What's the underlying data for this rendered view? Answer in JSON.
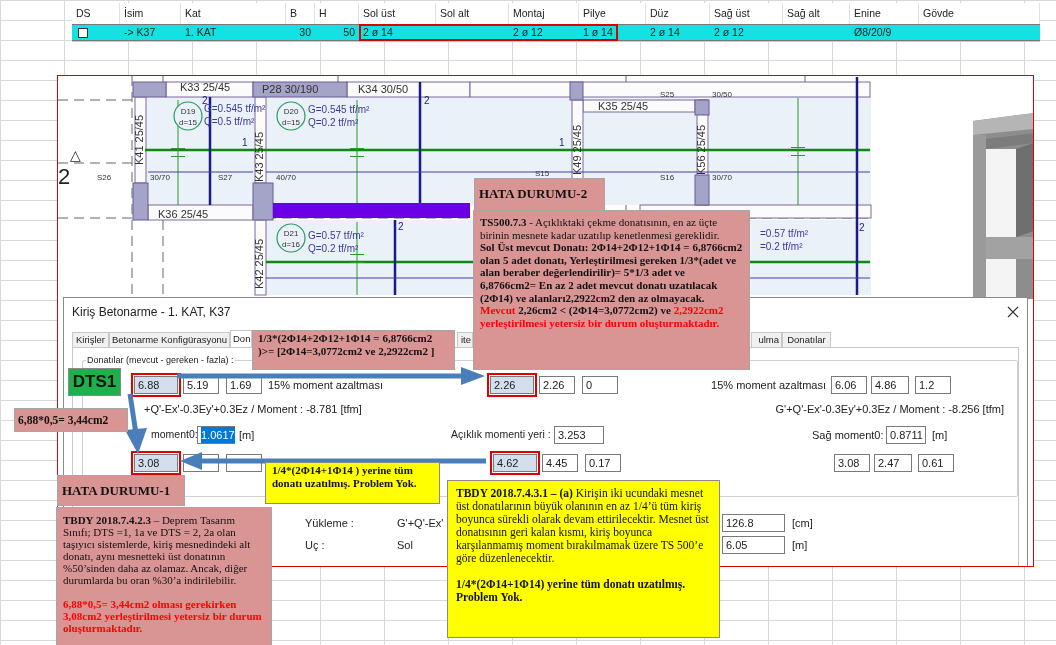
{
  "sheet_table": {
    "columns": [
      "DS",
      "İsim",
      "Kat",
      "B",
      "H",
      "Sol üst",
      "Sol alt",
      "Montaj",
      "Pilye",
      "Düz",
      "Sağ üst",
      "Sağ alt",
      "Enine",
      "Gövde"
    ],
    "rows": [
      {
        "selected": true,
        "cells": [
          {
            "kind": "checkbox",
            "checked": false
          },
          {
            "kind": "text",
            "text": "-> K37",
            "marked": false
          },
          {
            "kind": "text",
            "text": "1. KAT",
            "marked": false
          },
          {
            "kind": "text",
            "text": "30",
            "marked": false
          },
          {
            "kind": "text",
            "text": "50",
            "marked": false
          },
          {
            "kind": "text",
            "text": "2 ø 14",
            "marked": true
          },
          {
            "kind": "text",
            "marked": true
          },
          {
            "kind": "text",
            "text": "2 ø 12",
            "marked": true
          },
          {
            "kind": "text",
            "text": "1 ø 14",
            "marked": true
          },
          {
            "kind": "text",
            "text": "2 ø 14",
            "marked": false
          },
          {
            "kind": "text",
            "text": "2 ø 12",
            "marked": false
          },
          {
            "kind": "text",
            "marked": false
          },
          {
            "kind": "text",
            "text": "Ø8/20/9",
            "marked": false
          },
          {
            "kind": "text",
            "marked": false
          }
        ]
      }
    ]
  },
  "cad_drawing": {
    "labels": [
      {
        "text": "K33 25/45",
        "kind": "beam"
      },
      {
        "text": "P28 30/190",
        "kind": "beam"
      },
      {
        "text": "K34 30/50",
        "kind": "beam"
      },
      {
        "text": "G=0.545 tf/m²",
        "kind": "load"
      },
      {
        "text": "Q=0.5 tf/m²",
        "kind": "load"
      },
      {
        "text": "G=0.545 tf/m²",
        "kind": "load"
      },
      {
        "text": "Q=0.2 tf/m²",
        "kind": "load"
      },
      {
        "text": "K41 25/45",
        "kind": "beam"
      },
      {
        "text": "K43 25/45",
        "kind": "beam"
      },
      {
        "text": "△",
        "kind": "axis"
      },
      {
        "text": "2",
        "kind": "axis"
      },
      {
        "text": "S26",
        "kind": "span"
      },
      {
        "text": "30/70",
        "kind": "span"
      },
      {
        "text": "S27",
        "kind": "span"
      },
      {
        "text": "40/70",
        "kind": "span"
      },
      {
        "text": "K36 25/45",
        "kind": "beam"
      },
      {
        "text": "G=0.57 tf/m²",
        "kind": "load"
      },
      {
        "text": "Q=0.2 tf/m²",
        "kind": "load"
      },
      {
        "text": "K42 25/45",
        "kind": "beam"
      },
      {
        "text": "K35 25/45",
        "kind": "beam"
      },
      {
        "text": "S25",
        "kind": "span"
      },
      {
        "text": "30/50",
        "kind": "span"
      },
      {
        "text": "K49 25/45",
        "kind": "beam"
      },
      {
        "text": "K56 25/45",
        "kind": "beam"
      },
      {
        "text": "S15",
        "kind": "span"
      },
      {
        "text": "S16",
        "kind": "span"
      },
      {
        "text": "30/70",
        "kind": "span"
      },
      {
        "text": "=0.57 tf/m²",
        "kind": "load"
      },
      {
        "text": "=0.2 tf/m²",
        "kind": "load"
      },
      {
        "text": "2",
        "kind": "mark"
      },
      {
        "text": "2",
        "kind": "mark"
      },
      {
        "text": "1",
        "kind": "mark"
      },
      {
        "text": "2",
        "kind": "mark"
      },
      {
        "text": "1",
        "kind": "mark"
      },
      {
        "text": "2",
        "kind": "mark"
      }
    ],
    "slab_tags": [
      {
        "name": "D19",
        "thickness": "d=15"
      },
      {
        "name": "D20",
        "thickness": "d=15"
      },
      {
        "name": "D21",
        "thickness": "d=16"
      }
    ]
  },
  "dialog": {
    "title": "Kiriş Betonarme - 1. KAT, K37",
    "tabs": [
      {
        "label": "Kirişler",
        "selected": false
      },
      {
        "label": "Betonarme Konfigürasyonu",
        "selected": false
      },
      {
        "label": "Don",
        "selected": true
      },
      {
        "label": "ite",
        "selected": false
      },
      {
        "label": "ulma",
        "selected": false
      },
      {
        "label": "Donatılar",
        "selected": false
      }
    ],
    "group_label": "Donatılar (mevcut - gereken - fazla) :",
    "top_row": {
      "left": [
        {
          "value": "6.88",
          "marked": true
        },
        {
          "value": "5.19",
          "marked": false
        },
        {
          "value": "1.69",
          "marked": false
        }
      ],
      "left_note": "15% moment azaltması",
      "middle": [
        {
          "value": "2.26",
          "marked": true
        },
        {
          "value": "2.26",
          "marked": false
        },
        {
          "value": "0",
          "marked": false
        }
      ],
      "right_note": "15% moment azaltması",
      "right": [
        {
          "value": "6.06",
          "marked": false
        },
        {
          "value": "4.86",
          "marked": false
        },
        {
          "value": "1.2",
          "marked": false
        }
      ]
    },
    "moment_left": "+Q'-Ex'-0.3Ey'+0.3Ez / Moment : -8.781 [tfm]",
    "moment_right": "G'+Q'-Ex'-0.3Ey'+0.3Ez / Moment : -8.256 [tfm]",
    "left_moment0": {
      "label": "moment0:",
      "field": {
        "value": "1.0617",
        "selected": true
      },
      "unit": "[m]"
    },
    "span_location": {
      "label": "Açıklık momenti yeri :",
      "field": {
        "value": "3.253",
        "selected": false
      }
    },
    "right_moment0": {
      "label": "Sağ moment0:",
      "field": {
        "value": "0.8711",
        "selected": false
      },
      "unit": "[m]"
    },
    "bottom_row": {
      "left": [
        {
          "value": "3.08",
          "marked": true
        },
        {
          "marked": false
        },
        {
          "marked": false
        }
      ],
      "middle": [
        {
          "value": "4.62",
          "marked": true
        },
        {
          "value": "4.45",
          "marked": false
        },
        {
          "value": "0.17",
          "marked": false
        }
      ],
      "right": [
        {
          "value": "3.08",
          "marked": false
        },
        {
          "value": "2.47",
          "marked": false
        },
        {
          "value": "0.61",
          "marked": false
        }
      ]
    },
    "loading": {
      "label": "Yükleme :",
      "value": "G'+Q'-Ex'",
      "field": {
        "value": "126.8"
      },
      "unit": "[cm]"
    },
    "end": {
      "label": "Uç :",
      "value": "Sol",
      "field": {
        "value": "6.05"
      },
      "unit": "[m]"
    }
  },
  "callouts": [
    {
      "kind": "error",
      "paragraphs": [
        {
          "bold": true,
          "segments": [
            {
              "text": "HATA DURUMU-2",
              "red": false
            }
          ]
        }
      ]
    },
    {
      "kind": "error",
      "paragraphs": [
        {
          "bold": false,
          "segments": [
            {
              "text": "**TS500.7.3** - Açıklıktaki çekme donatısının, en az üçte birinin mesnete kadar uzatılıp kenetlenmesi gereklidir.",
              "red": false
            }
          ]
        },
        {
          "bold": true,
          "segments": [
            {
              "text": "Sol Üst mevcut Donatı: 2Φ14+2Φ12+1Φ14 = 6,8766cm2 olan 5 adet donatı, Yerleştirilmesi gereken 1/3*(adet ve alan beraber değerlendirilir)= 5*1/3 adet ve 6,8766cm2= En az 2 adet mevcut donatı uzatılacak (2Φ14) ve alanları2,2922cm2 den az olmayacak.",
              "red": false
            }
          ]
        },
        {
          "bold": true,
          "segments": [
            {
              "text": "Mevcut ",
              "red": true
            },
            {
              "text": "2,26cm2 < (2Φ14=3,0772cm2) ve ",
              "red": false
            },
            {
              "text": "2,2922cm2 yerleştirilmesi yetersiz bir durum oluşturmaktadır.",
              "red": true
            }
          ]
        }
      ]
    },
    {
      "kind": "error",
      "paragraphs": [
        {
          "bold": true,
          "segments": [
            {
              "text": "1/3*(2Φ14+2Φ12+1Φ14 = 6,8766cm2 )>= [2Φ14=3,0772cm2 ve 2,2922cm2 ]",
              "red": false
            }
          ]
        }
      ]
    },
    {
      "kind": "label",
      "paragraphs": [
        {
          "bold": true,
          "segments": [
            {
              "text": "DTS1",
              "red": false
            }
          ]
        }
      ]
    },
    {
      "kind": "error",
      "paragraphs": [
        {
          "bold": true,
          "segments": [
            {
              "text": "6,88*0,5= 3,44cm2",
              "red": false
            }
          ]
        }
      ]
    },
    {
      "kind": "ok",
      "paragraphs": [
        {
          "bold": true,
          "segments": [
            {
              "text": "1/4*(2Φ14+1Φ14 ) yerine tüm donatı uzatılmış. Problem Yok.",
              "red": false
            }
          ]
        }
      ]
    },
    {
      "kind": "error",
      "paragraphs": [
        {
          "bold": true,
          "segments": [
            {
              "text": "HATA DURUMU-1",
              "red": false
            }
          ]
        }
      ]
    },
    {
      "kind": "error",
      "paragraphs": [
        {
          "bold": false,
          "segments": [
            {
              "text": "**TBDY 2018.7.4.2.3** – Deprem Tasarım Sınıfı; DTS =1, 1a ve DTS = 2, 2a olan taşıyıcı sistemlerde, kiriş mesnedindeki alt donatı, aynı mesnetteki üst donatının %50’sinden daha az olamaz. Ancak, diğer durumlarda bu oran %30’a indirilebilir.",
              "red": false
            }
          ]
        },
        {
          "bold": true,
          "segments": [
            {
              "text": "6,88*0,5= 3,44cm2 olması gerekirken 3,08cm2 yerleştirilmesi yetersiz bir durum oluşturmaktadır.",
              "red": true
            }
          ]
        }
      ]
    },
    {
      "kind": "ok",
      "paragraphs": [
        {
          "bold": false,
          "segments": [
            {
              "text": "**TBDY 2018.7.4.3.1 – (a)** Kirişin iki ucundaki mesnet üst donatılarının büyük olanının en az 1/4’ü tüm kiriş boyunca sürekli olarak devam ettirilecektir. Mesnet üst donatısının geri kalan kısmı, kiriş boyunca karşılanmamış moment bırakılmamak üzere TS 500’e göre düzenlenecektir.",
              "red": false
            }
          ]
        },
        {
          "bold": true,
          "segments": [
            {
              "text": "1/4*(2Φ14+1Φ14) yerine tüm donatı uzatılmış. Problem Yok.",
              "red": false
            }
          ]
        }
      ]
    }
  ]
}
